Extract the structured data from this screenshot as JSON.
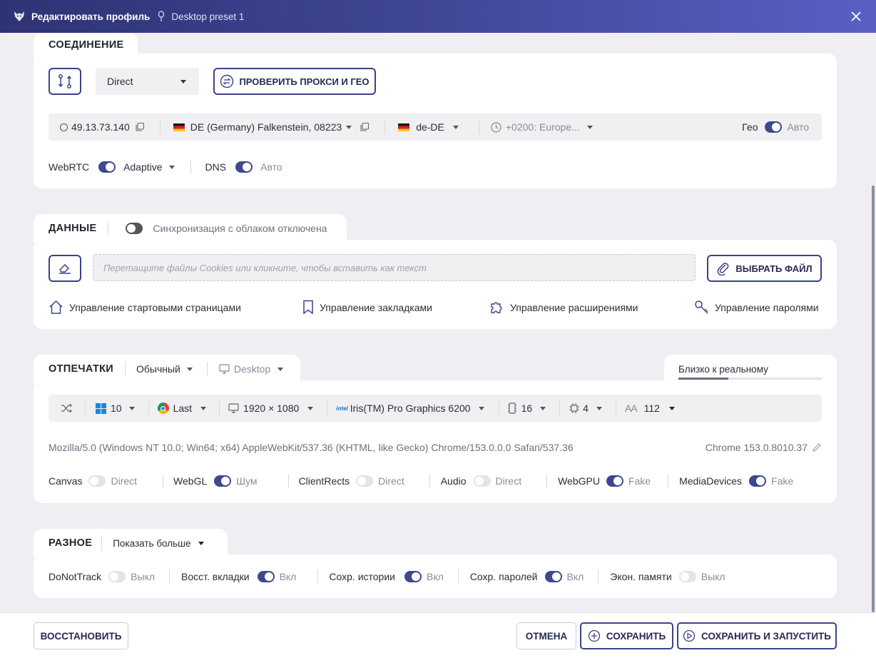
{
  "window": {
    "title": "Редактировать профиль",
    "preset": "Desktop preset 1"
  },
  "connection": {
    "title": "СОЕДИНЕНИЕ",
    "proxy_type": "Direct",
    "check_button": "ПРОВЕРИТЬ ПРОКСИ И ГЕО",
    "ip": "49.13.73.140",
    "location": "DE (Germany) Falkenstein, 08223",
    "language": "de-DE",
    "timezone": "+0200: Europe...",
    "geo_label": "Гео",
    "geo_value": "Авто",
    "webrtc_label": "WebRTC",
    "webrtc_value": "Adaptive",
    "dns_label": "DNS",
    "dns_value": "Авто"
  },
  "data_section": {
    "title": "ДАННЫЕ",
    "sync_label": "Синхронизация с облаком отключена",
    "cookies_placeholder": "Перетащите файлы Cookies или кликните, чтобы вставить как текст",
    "choose_file": "ВЫБРАТЬ ФАЙЛ",
    "links": {
      "start_pages": "Управление стартовыми страницами",
      "bookmarks": "Управление закладками",
      "extensions": "Управление расширениями",
      "passwords": "Управление паролями"
    }
  },
  "fingerprints": {
    "title": "ОТПЕЧАТКИ",
    "mode": "Обычный",
    "device": "Desktop",
    "realism_label": "Близко к реальному",
    "realism_level": 0.35,
    "os": "10",
    "browser": "Last",
    "resolution": "1920 × 1080",
    "gpu": "Iris(TM) Pro Graphics 6200",
    "ram": "16",
    "cpu": "4",
    "fonts": "112",
    "user_agent": "Mozilla/5.0 (Windows NT 10.0; Win64; x64) AppleWebKit/537.36 (KHTML, like Gecko) Chrome/153.0.0.0 Safari/537.36",
    "chrome_version": "Chrome 153.0.8010.37",
    "toggles": [
      {
        "label": "Canvas",
        "value": "Direct",
        "on": false
      },
      {
        "label": "WebGL",
        "value": "Шум",
        "on": true
      },
      {
        "label": "ClientRects",
        "value": "Direct",
        "on": false
      },
      {
        "label": "Audio",
        "value": "Direct",
        "on": false
      },
      {
        "label": "WebGPU",
        "value": "Fake",
        "on": true
      },
      {
        "label": "MediaDevices",
        "value": "Fake",
        "on": true
      }
    ]
  },
  "misc": {
    "title": "РАЗНОЕ",
    "show_more": "Показать больше",
    "toggles": [
      {
        "label": "DoNotTrack",
        "value": "Выкл",
        "on": false
      },
      {
        "label": "Восст. вкладки",
        "value": "Вкл",
        "on": true
      },
      {
        "label": "Сохр. истории",
        "value": "Вкл",
        "on": true
      },
      {
        "label": "Сохр. паролей",
        "value": "Вкл",
        "on": true
      },
      {
        "label": "Экон. памяти",
        "value": "Выкл",
        "on": false
      }
    ]
  },
  "footer": {
    "restore": "ВОССТАНОВИТЬ",
    "cancel": "ОТМЕНА",
    "save": "СОХРАНИТЬ",
    "save_run": "СОХРАНИТЬ И ЗАПУСТИТЬ"
  },
  "colors": {
    "accent": "#3f478f",
    "title_gradient_start": "#2e3375",
    "title_gradient_end": "#5a5fc4",
    "background": "#efeff3"
  }
}
